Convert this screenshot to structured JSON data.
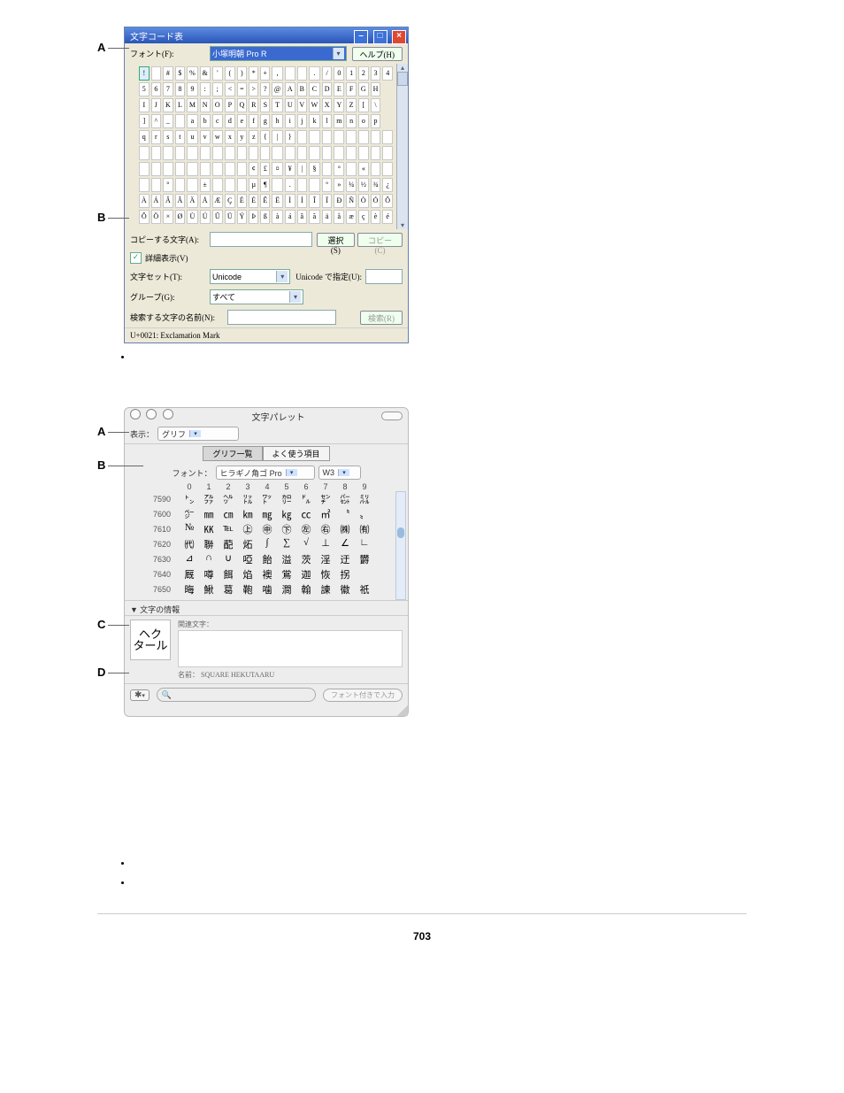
{
  "page_number": "703",
  "windows": {
    "title_a": "文字コード表",
    "font_label_a": "フォント(F):",
    "font_value_a": "小塚明朝 Pro R",
    "help_btn": "ヘルプ(H)",
    "copy_label": "コピーする文字(A):",
    "select_btn": "選択(S)",
    "copy_btn": "コピー(C)",
    "adv_chk": "詳細表示(V)",
    "charset_label": "文字セット(T):",
    "charset_value": "Unicode",
    "unicode_btn": "Unicode で指定(U):",
    "group_label": "グループ(G):",
    "group_value": "すべて",
    "search_label": "検索する文字の名前(N):",
    "search_btn": "検索(R)",
    "status": "U+0021: Exclamation Mark"
  },
  "grid_a": [
    [
      "!",
      "",
      "#",
      "$",
      "%",
      "&",
      "'",
      "(",
      ")",
      "*",
      "+",
      ",",
      "",
      "",
      ".",
      "/",
      "0",
      "1",
      "2",
      "3",
      "4"
    ],
    [
      "5",
      "6",
      "7",
      "8",
      "9",
      ":",
      ";",
      "<",
      "=",
      ">",
      "?",
      "@",
      "A",
      "B",
      "C",
      "D",
      "E",
      "F",
      "G",
      "H"
    ],
    [
      "I",
      "J",
      "K",
      "L",
      "M",
      "N",
      "O",
      "P",
      "Q",
      "R",
      "S",
      "T",
      "U",
      "V",
      "W",
      "X",
      "Y",
      "Z",
      "[",
      "\\"
    ],
    [
      "]",
      "^",
      "_",
      "",
      "a",
      "b",
      "c",
      "d",
      "e",
      "f",
      "g",
      "h",
      "i",
      "j",
      "k",
      "l",
      "m",
      "n",
      "o",
      "p"
    ],
    [
      "q",
      "r",
      "s",
      "t",
      "u",
      "v",
      "w",
      "x",
      "y",
      "z",
      "{",
      "|",
      "}",
      "",
      "",
      "",
      "",
      "",
      "",
      "",
      " "
    ],
    [
      "",
      "",
      "",
      "",
      "",
      "",
      "",
      " ",
      "",
      "",
      "",
      "",
      "",
      "",
      "",
      "",
      "",
      "",
      "",
      "",
      " "
    ],
    [
      "",
      "",
      "",
      "",
      "",
      "",
      "",
      "",
      "",
      "¢",
      "£",
      "¤",
      "¥",
      "|",
      "§",
      "",
      "°",
      "",
      "«",
      "",
      " "
    ],
    [
      "",
      "",
      "°",
      "",
      "",
      "±",
      "",
      "",
      "",
      "µ",
      "¶",
      "",
      ".",
      "",
      " ",
      "º",
      "»",
      "¼",
      "½",
      "¾",
      "¿"
    ],
    [
      "À",
      "Á",
      "Â",
      "Ã",
      "Ä",
      "Å",
      "Æ",
      "Ç",
      "È",
      "É",
      "Ê",
      "Ë",
      "Ì",
      "Í",
      "Î",
      "Ï",
      "Ð",
      "Ñ",
      "Ò",
      "Ó",
      "Ô"
    ],
    [
      "Õ",
      "Ö",
      "×",
      "Ø",
      "Ù",
      "Ú",
      "Û",
      "Ü",
      "Ý",
      "Þ",
      "ß",
      "à",
      "á",
      "â",
      "ã",
      "ä",
      "å",
      "æ",
      "ç",
      "è",
      "é"
    ]
  ],
  "mac": {
    "title": "文字パレット",
    "view_label": "表示：",
    "view_value": "グリフ",
    "tab1": "グリフ一覧",
    "tab2": "よく使う項目",
    "font_label": "フォント：",
    "font_value": "ヒラギノ角ゴ Pro",
    "weight": "W3",
    "cols": [
      "0",
      "1",
      "2",
      "3",
      "4",
      "5",
      "6",
      "7",
      "8",
      "9"
    ],
    "rows": [
      {
        "i": "7590",
        "g": [
          "㌧",
          "㌁",
          "㌹",
          "㍑",
          "㍗",
          "㌍",
          "㌦",
          "㌢",
          "㌫",
          "㍊"
        ]
      },
      {
        "i": "7600",
        "g": [
          "㌻",
          "㎜",
          "㎝",
          "㎞",
          "㎎",
          "㎏",
          "㏄",
          "㎡",
          "〝",
          "〟"
        ]
      },
      {
        "i": "7610",
        "g": [
          "№",
          "㏍",
          "℡",
          "㊤",
          "㊥",
          "㊦",
          "㊧",
          "㊨",
          "㈱",
          "㈲"
        ]
      },
      {
        "i": "7620",
        "g": [
          "㈹",
          "聨",
          "蓜",
          "炻",
          "∫",
          "∑",
          "√",
          "⊥",
          "∠",
          "∟"
        ]
      },
      {
        "i": "7630",
        "g": [
          "⊿",
          "∩",
          "∪",
          "啞",
          "飴",
          "溢",
          "茨",
          "淫",
          "迂",
          "欝"
        ]
      },
      {
        "i": "7640",
        "g": [
          "厩",
          "噂",
          "餌",
          "焰",
          "襖",
          "鴬",
          "迦",
          "恢",
          "拐"
        ]
      },
      {
        "i": "7650",
        "g": [
          "晦",
          "鰍",
          "葛",
          "鞄",
          "噛",
          "澗",
          "翰",
          "諌",
          "徽",
          "祇"
        ]
      }
    ],
    "info_head": "▼ 文字の情報",
    "related": "関連文字：",
    "big": "ヘク\nタール",
    "name_lab": "名前：",
    "name_val": "SQUARE HEKUTAARU",
    "insert_btn": "フォント付きで入力"
  },
  "labels": {
    "A": "A",
    "B": "B",
    "C": "C",
    "D": "D"
  }
}
